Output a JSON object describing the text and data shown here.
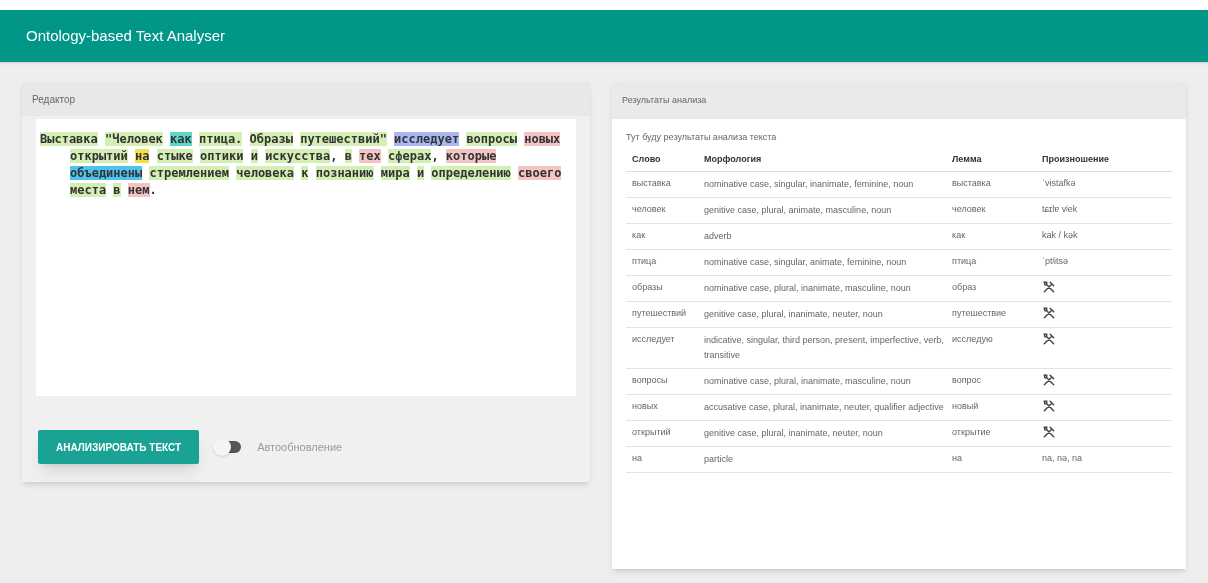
{
  "app_bar": {
    "title": "Ontology-based Text Analyser"
  },
  "editor": {
    "title": "Редактор",
    "lines": [
      [
        {
          "text": "Выставка",
          "color": "#d4efb4"
        },
        {
          "text": "\"Человек",
          "color": "#d4efb4"
        },
        {
          "text": "как",
          "color": "#5fd6c4"
        },
        {
          "text": "птица.",
          "color": "#d4efb4"
        },
        {
          "text": "Образы",
          "color": "#d4efb4"
        },
        {
          "text": "путешествий\"",
          "color": "#d4efb4"
        },
        {
          "text": "исследует",
          "color": "#aab8f2"
        },
        {
          "text": "вопросы",
          "color": "#d4efb4"
        },
        {
          "text": "новых",
          "color": "#f4c4c4"
        }
      ],
      [
        {
          "text": "открытий",
          "color": "#d4efb4"
        },
        {
          "text": "на",
          "color": "#f2e04a"
        },
        {
          "text": "стыке",
          "color": "#d4efb4"
        },
        {
          "text": "оптики",
          "color": "#d4efb4"
        },
        {
          "text": "и",
          "color": "#d4efb4"
        },
        {
          "text": "искусства",
          "color": "#d4efb4",
          "trail": ","
        },
        {
          "text": "в",
          "color": "#d4efb4"
        },
        {
          "text": "тех",
          "color": "#f4c4c4"
        },
        {
          "text": "сферах",
          "color": "#d4efb4",
          "trail": ","
        },
        {
          "text": "которые",
          "color": "#f4c4c4"
        }
      ],
      [
        {
          "text": "объединены",
          "color": "#4ec3f0"
        },
        {
          "text": "стремлением",
          "color": "#d4efb4"
        },
        {
          "text": "человека",
          "color": "#d4efb4"
        },
        {
          "text": "к",
          "color": "#d4efb4"
        },
        {
          "text": "познанию",
          "color": "#d4efb4"
        },
        {
          "text": "мира",
          "color": "#d4efb4"
        },
        {
          "text": "и",
          "color": "#d4efb4"
        },
        {
          "text": "определению",
          "color": "#d4efb4"
        },
        {
          "text": "своего",
          "color": "#f4c4c4"
        }
      ],
      [
        {
          "text": "места",
          "color": "#d4efb4"
        },
        {
          "text": "в",
          "color": "#d4efb4"
        },
        {
          "text": "нем",
          "color": "#f4c4c4",
          "trail": "."
        }
      ]
    ],
    "analyze_button": "АНАЛИЗИРОВАТЬ ТЕКСТ",
    "auto_update": {
      "label": "Автообновление",
      "on": false
    }
  },
  "results": {
    "title": "Результаты анализа",
    "note": "Тут буду результаты анализа текста",
    "columns": [
      "Слово",
      "Морфология",
      "Лемма",
      "Произношение"
    ],
    "rows": [
      {
        "word": "выставка",
        "morphology": "nominative case, singular, inanimate, feminine, noun",
        "lemma": "выставка",
        "kind": "text",
        "pronunciation": "ˈvɨstafkə"
      },
      {
        "word": "человек",
        "morphology": "genitive case, plural, animate, masculine, noun",
        "lemma": "человек",
        "kind": "text",
        "pronunciation": "tɕɪlɐ vʲek"
      },
      {
        "word": "как",
        "morphology": "adverb",
        "lemma": "как",
        "kind": "text",
        "pronunciation": "kak / kək"
      },
      {
        "word": "птица",
        "morphology": "nominative case, singular, animate, feminine, noun",
        "lemma": "птица",
        "kind": "text",
        "pronunciation": "ˈptʲitsə"
      },
      {
        "word": "образы",
        "morphology": "nominative case, plural, inanimate, masculine, noun",
        "lemma": "образ",
        "kind": "tool"
      },
      {
        "word": "путешествий",
        "morphology": "genitive case, plural, inanimate, neuter, noun",
        "lemma": "путешествие",
        "kind": "tool"
      },
      {
        "word": "исследует",
        "morphology": "indicative, singular, third person, present, imperfective, verb, transitive",
        "lemma": "исследую",
        "kind": "tool"
      },
      {
        "word": "вопросы",
        "morphology": "nominative case, plural, inanimate, masculine, noun",
        "lemma": "вопрос",
        "kind": "tool"
      },
      {
        "word": "новых",
        "morphology": "accusative case, plural, inanimate, neuter, qualifier adjective",
        "lemma": "новый",
        "kind": "tool"
      },
      {
        "word": "открытий",
        "morphology": "genitive case, plural, inanimate, neuter, noun",
        "lemma": "открытие",
        "kind": "tool"
      },
      {
        "word": "на",
        "morphology": "particle",
        "lemma": "на",
        "kind": "text",
        "pronunciation": "na, nə, na"
      }
    ]
  }
}
